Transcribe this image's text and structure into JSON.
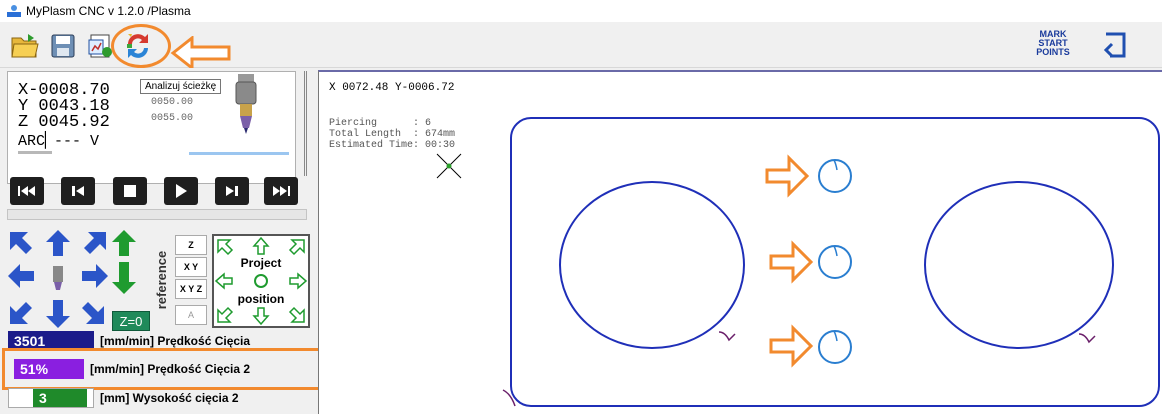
{
  "window": {
    "title": "MyPlasm CNC v 1.2.0  /Plasma"
  },
  "toolbar": {
    "mark_start_points": [
      "MARK",
      "START",
      "POINTS"
    ],
    "tooltip": "Analizuj ścieżkę"
  },
  "dro": {
    "x": "X-0008.70",
    "y": "Y 0043.18",
    "z": "Z 0045.92",
    "x_small": "00.00",
    "y_small": "0050.00",
    "z_small": "0055.00",
    "arc": "ARC▏--- V"
  },
  "transport": {
    "buttons": [
      "first",
      "prev",
      "stop",
      "play",
      "next",
      "last"
    ]
  },
  "reference": {
    "label": "reference",
    "buttons": [
      "Z",
      "X Y",
      "X Y Z",
      "A"
    ],
    "z_zero": "Z=0"
  },
  "project": {
    "line1": "Project",
    "line2": "position"
  },
  "fields": [
    {
      "value": "3501",
      "label": "[mm/min] Prędkość Cięcia",
      "bg": "#1b1b8a"
    },
    {
      "value": "51%",
      "label": "[mm/min] Prędkość Cięcia 2",
      "bg": "#8a1fe0"
    },
    {
      "value": "3",
      "label": "[mm] Wysokość cięcia 2",
      "bg": "#1f8a2a"
    }
  ],
  "canvas": {
    "coords": "X 0072.48  Y-0006.72",
    "info": "Piercing      : 6\nTotal Length  : 674mm\nEstimated Time: 00:30"
  },
  "colors": {
    "accent": "#f28a2e",
    "path": "#1f2fb8",
    "hole": "#2a7ed0"
  }
}
